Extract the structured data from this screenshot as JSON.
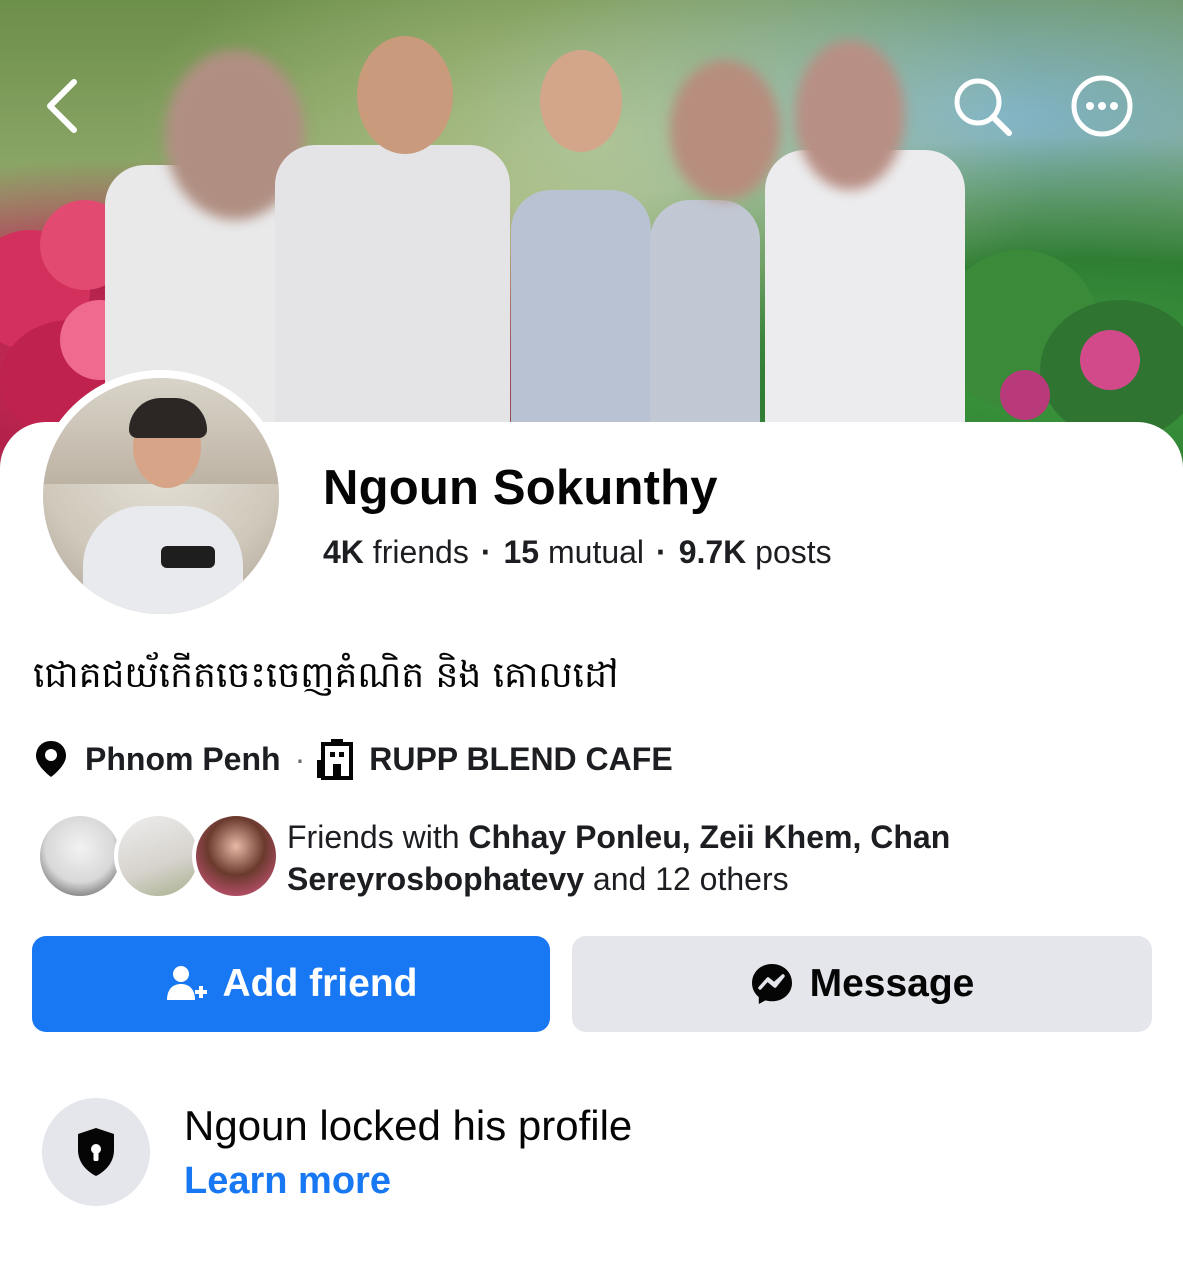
{
  "header": {
    "back_icon": "chevron-left-icon",
    "search_icon": "search-icon",
    "more_icon": "more-options-icon"
  },
  "profile": {
    "name": "Ngoun Sokunthy",
    "friends_count": "4K",
    "friends_label": "friends",
    "mutual_count": "15",
    "mutual_label": "mutual",
    "posts_count": "9.7K",
    "posts_label": "posts",
    "bio": "ជោគជយ័កើតចេះចេញគំណិត និង គោលដៅ",
    "location": "Phnom Penh",
    "workplace": "RUPP BLEND CAFE"
  },
  "mutual_friends": {
    "prefix": "Friends with ",
    "names": "Chhay Ponleu, Zeii Khem, Chan Sereyrosbophatevy",
    "suffix": " and 12 others"
  },
  "actions": {
    "add_friend_label": "Add friend",
    "message_label": "Message"
  },
  "lock_notice": {
    "title": "Ngoun locked his profile",
    "link": "Learn more"
  },
  "colors": {
    "accent": "#1877f2",
    "secondary_button": "#e4e6eb",
    "text_primary": "#050505"
  }
}
